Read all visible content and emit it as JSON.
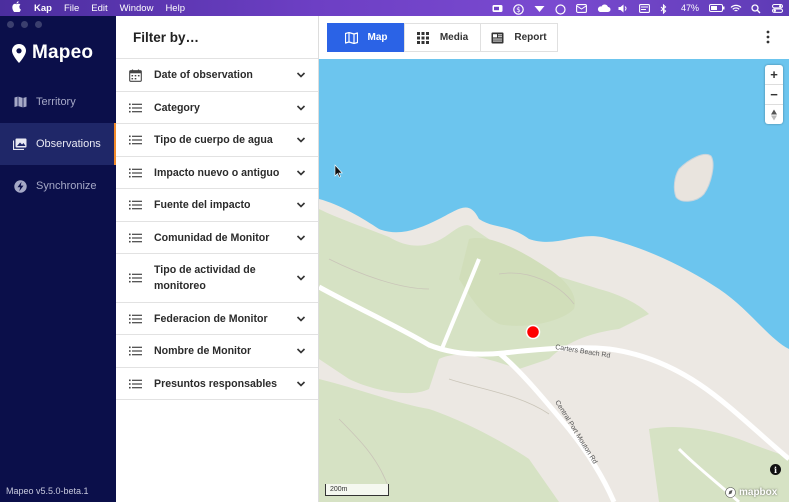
{
  "menubar": {
    "apple": "",
    "items": [
      "Kap",
      "File",
      "Edit",
      "Window",
      "Help"
    ],
    "battery": "47%"
  },
  "app": {
    "brand": "Mapeo",
    "version": "Mapeo v5.5.0-beta.1"
  },
  "sidebar": {
    "items": [
      {
        "label": "Territory",
        "icon": "map-icon",
        "active": false
      },
      {
        "label": "Observations",
        "icon": "photos-icon",
        "active": true
      },
      {
        "label": "Synchronize",
        "icon": "lightning-icon",
        "active": false
      }
    ]
  },
  "filters": {
    "title": "Filter by…",
    "items": [
      {
        "label": "Date of observation",
        "icon": "calendar-icon"
      },
      {
        "label": "Category",
        "icon": "list-icon"
      },
      {
        "label": "Tipo de cuerpo de agua",
        "icon": "list-icon"
      },
      {
        "label": "Impacto nuevo o antiguo",
        "icon": "list-icon"
      },
      {
        "label": "Fuente del impacto",
        "icon": "list-icon"
      },
      {
        "label": "Comunidad de Monitor",
        "icon": "list-icon"
      },
      {
        "label": "Tipo de actividad de monitoreo",
        "icon": "list-icon"
      },
      {
        "label": "Federacion de Monitor",
        "icon": "list-icon"
      },
      {
        "label": "Nombre de Monitor",
        "icon": "list-icon"
      },
      {
        "label": "Presuntos responsables",
        "icon": "list-icon"
      }
    ]
  },
  "tabs": [
    {
      "label": "Map",
      "icon": "map-icon",
      "active": true
    },
    {
      "label": "Media",
      "icon": "grid-icon",
      "active": false
    },
    {
      "label": "Report",
      "icon": "report-icon",
      "active": false
    }
  ],
  "map": {
    "zoom_in": "+",
    "zoom_out": "−",
    "scale_label": "200m",
    "road_label_1": "Carters Beach Rd",
    "road_label_2": "Central Port Mouton Rd",
    "attribution": "mapbox",
    "info": "i",
    "colors": {
      "water": "#6cc5ee",
      "land": "#ece8e3",
      "green": "#d6e2c4",
      "road": "#ffffff",
      "marker": "#ff0000"
    }
  }
}
